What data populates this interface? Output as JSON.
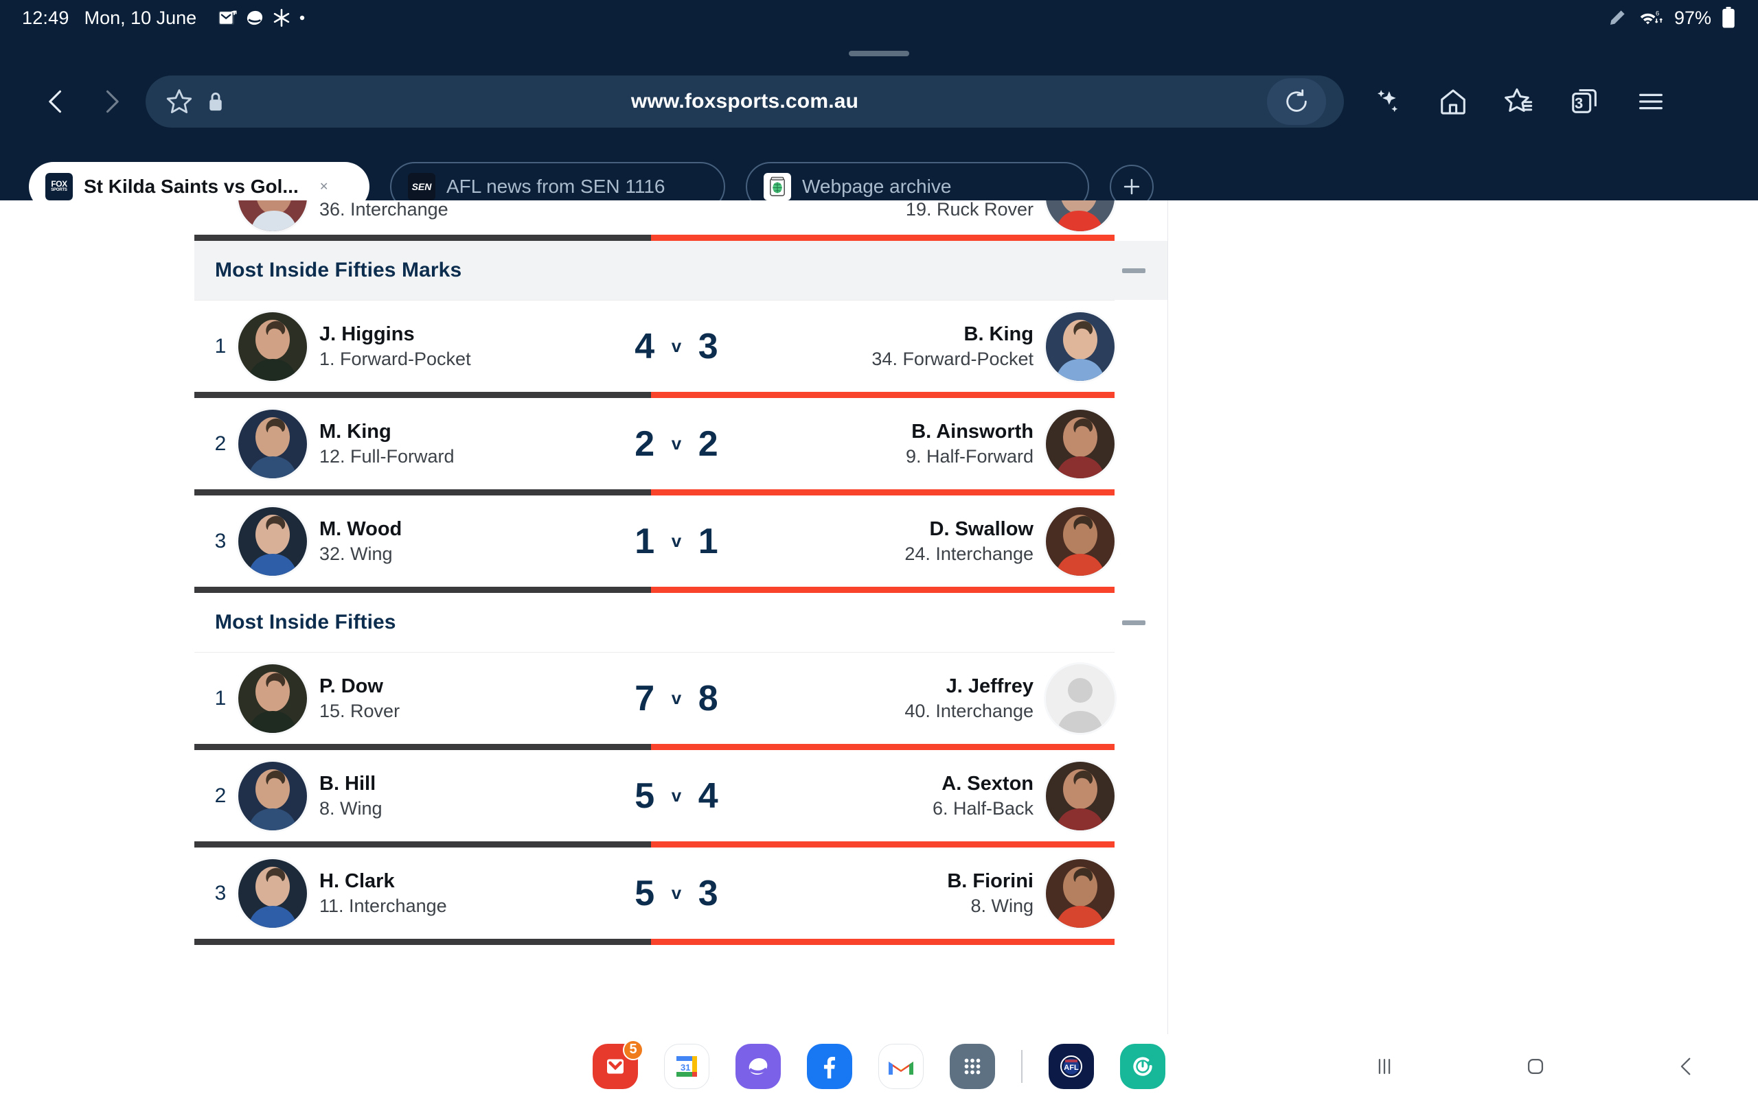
{
  "status_bar": {
    "time": "12:49",
    "date": "Mon, 10 June",
    "battery": "97%",
    "icons": [
      "email-icon",
      "samsung-pay-icon",
      "snowflake-icon",
      "dot-icon"
    ],
    "right_icons": [
      "pen-icon",
      "wifi-data-icon",
      "battery-icon"
    ]
  },
  "browser": {
    "url": "www.foxsports.com.au",
    "back_label": "Back",
    "forward_label": "Forward",
    "toolbar_icons": [
      "reload-icon",
      "sparkle-ai-icon",
      "home-icon",
      "bookmarks-icon",
      "tabs-icon",
      "menu-icon"
    ],
    "tab_count": "3",
    "tabs": [
      {
        "title": "St Kilda Saints vs Gol...",
        "favicon": "foxsports-icon",
        "active": true,
        "close_label": "✕"
      },
      {
        "title": "AFL news from SEN 1116",
        "favicon": "sen-icon",
        "active": false
      },
      {
        "title": "Webpage archive",
        "favicon": "archive-jar-icon",
        "active": false
      }
    ],
    "new_tab_label": "+"
  },
  "content": {
    "clipped_row": {
      "left_pos": "36. Interchange",
      "right_pos": "19. Ruck Rover"
    },
    "sections": [
      {
        "title": "Most Inside Fifties Marks",
        "shaded": true,
        "toggle": "collapse-toggle",
        "rows": [
          {
            "rank": "1",
            "left": {
              "name": "J. Higgins",
              "pos": "1. Forward-Pocket",
              "score": "4",
              "avatar": "player-photo"
            },
            "right": {
              "name": "B. King",
              "pos": "34. Forward-Pocket",
              "score": "3",
              "avatar": "player-photo"
            },
            "vs": "v"
          },
          {
            "rank": "2",
            "left": {
              "name": "M. King",
              "pos": "12. Full-Forward",
              "score": "2",
              "avatar": "player-photo"
            },
            "right": {
              "name": "B. Ainsworth",
              "pos": "9. Half-Forward",
              "score": "2",
              "avatar": "player-photo"
            },
            "vs": "v"
          },
          {
            "rank": "3",
            "left": {
              "name": "M. Wood",
              "pos": "32. Wing",
              "score": "1",
              "avatar": "player-photo"
            },
            "right": {
              "name": "D. Swallow",
              "pos": "24. Interchange",
              "score": "1",
              "avatar": "player-photo"
            },
            "vs": "v"
          }
        ]
      },
      {
        "title": "Most Inside Fifties",
        "shaded": false,
        "toggle": "collapse-toggle",
        "rows": [
          {
            "rank": "1",
            "left": {
              "name": "P. Dow",
              "pos": "15. Rover",
              "score": "7",
              "avatar": "player-photo"
            },
            "right": {
              "name": "J. Jeffrey",
              "pos": "40. Interchange",
              "score": "8",
              "avatar": "placeholder-avatar"
            },
            "vs": "v"
          },
          {
            "rank": "2",
            "left": {
              "name": "B. Hill",
              "pos": "8. Wing",
              "score": "5",
              "avatar": "player-photo"
            },
            "right": {
              "name": "A. Sexton",
              "pos": "6. Half-Back",
              "score": "4",
              "avatar": "player-photo"
            },
            "vs": "v"
          },
          {
            "rank": "3",
            "left": {
              "name": "H. Clark",
              "pos": "11. Interchange",
              "score": "5",
              "avatar": "player-photo"
            },
            "right": {
              "name": "B. Fiorini",
              "pos": "8. Wing",
              "score": "3",
              "avatar": "player-photo"
            },
            "vs": "v"
          }
        ]
      }
    ],
    "colors": {
      "team_left_bar": "#3a3a3c",
      "team_right_bar": "#f9432a",
      "score_navy": "#0d2d4e",
      "section_shaded_bg": "#f1f3f5"
    }
  },
  "dock": {
    "apps": [
      {
        "name": "email-app-icon",
        "badge": "5"
      },
      {
        "name": "calendar-app-icon",
        "day": "31"
      },
      {
        "name": "samsung-internet-app-icon"
      },
      {
        "name": "facebook-app-icon"
      },
      {
        "name": "gmail-app-icon"
      },
      {
        "name": "apps-drawer-icon"
      },
      {
        "name": "afl-app-icon"
      },
      {
        "name": "refresh-app-icon"
      }
    ]
  },
  "nav_bar": {
    "recents_label": "Recents",
    "home_label": "Home",
    "back_label": "Back"
  }
}
